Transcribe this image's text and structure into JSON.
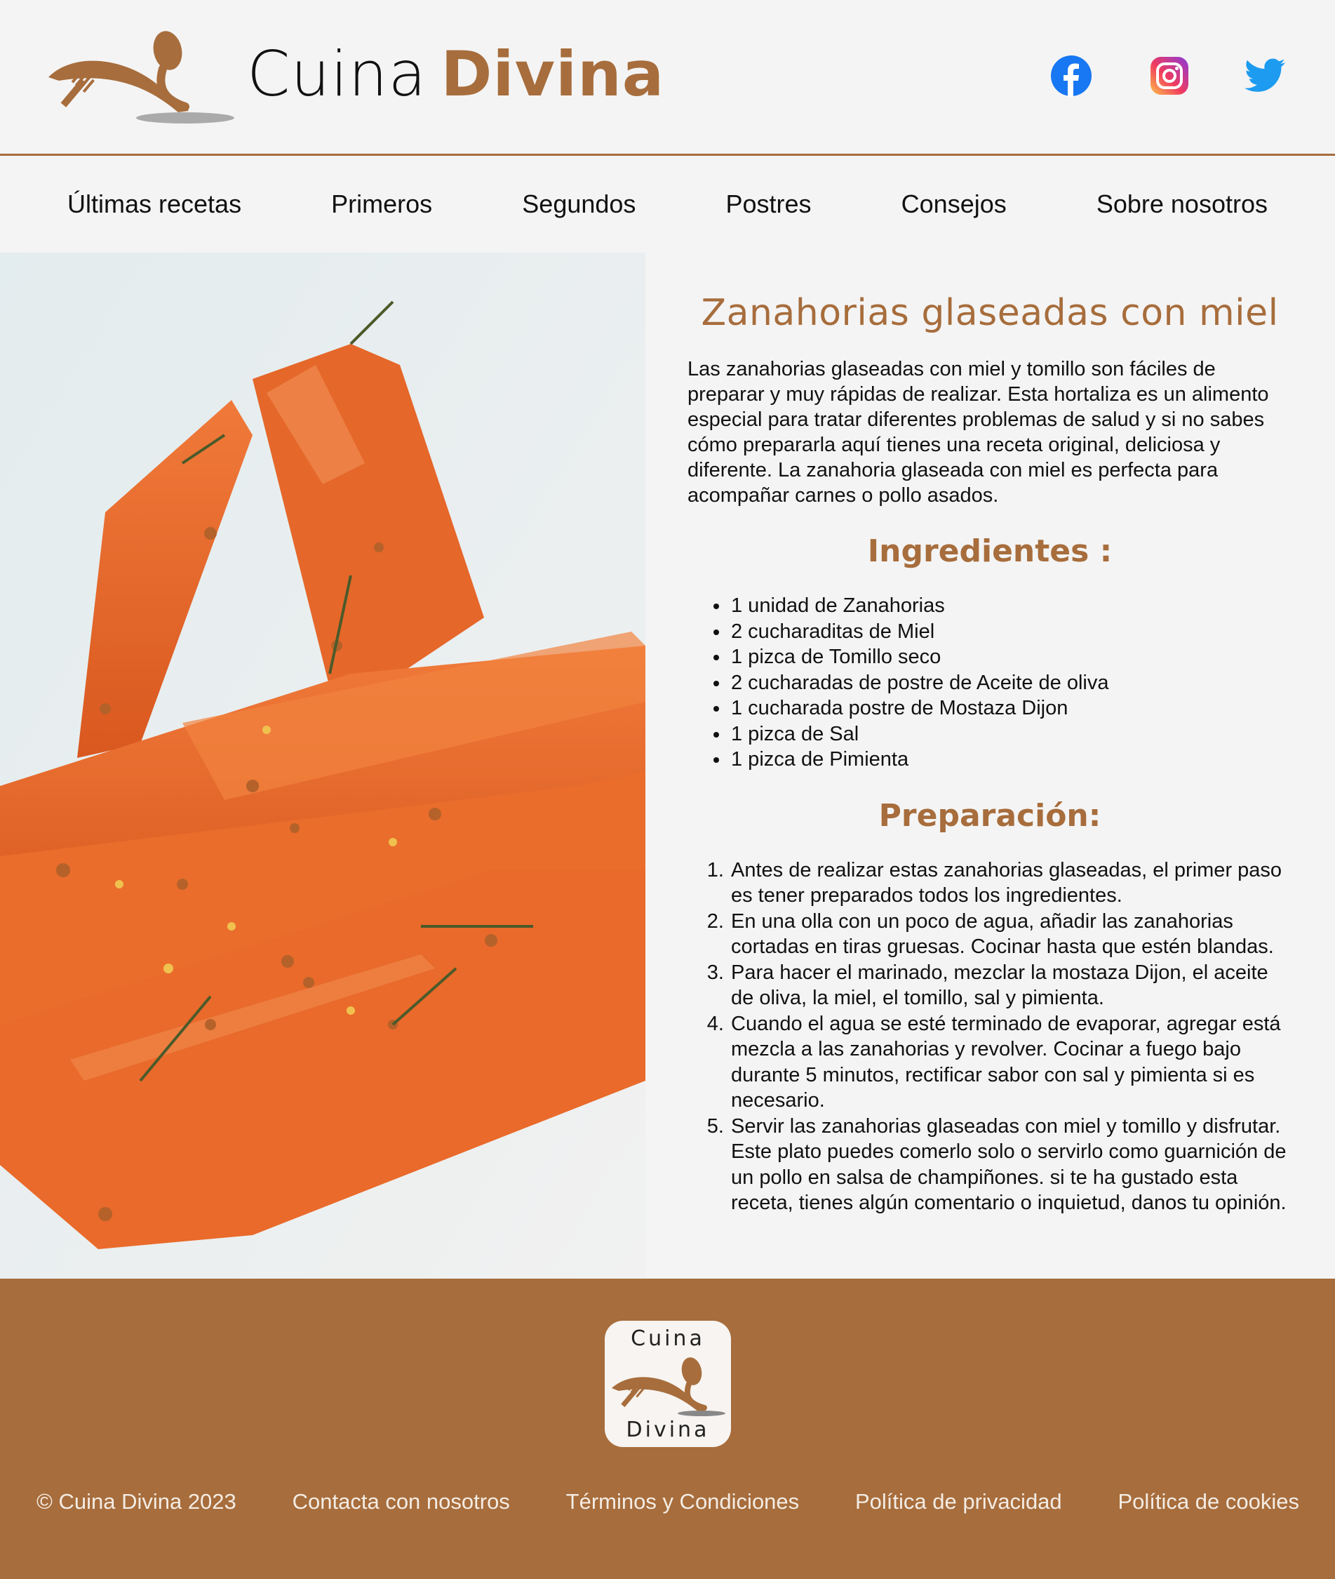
{
  "header": {
    "brand_word1": "Cuina",
    "brand_word2": "Divina",
    "social": [
      "facebook-icon",
      "instagram-icon",
      "twitter-icon"
    ]
  },
  "nav": {
    "items": [
      "Últimas recetas",
      "Primeros",
      "Segundos",
      "Postres",
      "Consejos",
      "Sobre nosotros"
    ]
  },
  "recipe": {
    "title": "Zanahorias glaseadas con miel",
    "intro": "Las zanahorias glaseadas con miel y tomillo son fáciles de preparar y muy rápidas de realizar. Esta hortaliza es un alimento especial para tratar diferentes problemas de salud y si no sabes cómo prepararla aquí tienes una receta original, deliciosa y diferente. La zanahoria glaseada con miel es perfecta para acompañar carnes o pollo asados.",
    "ingredients_heading": "Ingredientes :",
    "ingredients": [
      "1 unidad de Zanahorias",
      "2 cucharaditas de Miel",
      "1 pizca de Tomillo seco",
      "2 cucharadas de postre de Aceite de oliva",
      "1 cucharada postre de Mostaza Dijon",
      "1 pizca de Sal",
      "1 pizca de Pimienta"
    ],
    "preparation_heading": "Preparación:",
    "steps": [
      "Antes de realizar estas zanahorias glaseadas, el primer paso es tener preparados todos los ingredientes.",
      "En una olla con un poco de agua, añadir las zanahorias cortadas en tiras gruesas. Cocinar hasta que estén blandas.",
      "Para hacer el marinado, mezclar la mostaza Dijon, el aceite de oliva, la miel, el tomillo, sal y pimienta.",
      "Cuando el agua se esté terminado de evaporar, agregar está mezcla a las zanahorias y revolver. Cocinar a fuego bajo durante 5 minutos, rectificar sabor con sal y pimienta si es necesario.",
      "Servir las zanahorias glaseadas con miel y tomillo y disfrutar. Este plato puedes comerlo solo o servirlo como guarnición de un pollo en salsa de champiñones. si te ha gustado esta receta, tienes algún comentario o inquietud, danos tu opinión."
    ]
  },
  "footer": {
    "logo_word1": "Cuina",
    "logo_word2": "Divina",
    "links": [
      "© Cuina Divina 2023",
      "Contacta con nosotros",
      "Términos y Condiciones",
      "Política de privacidad",
      "Política de cookies"
    ]
  },
  "colors": {
    "accent": "#a76d3c",
    "background": "#f4f4f4",
    "carrot": "#e8672a"
  }
}
